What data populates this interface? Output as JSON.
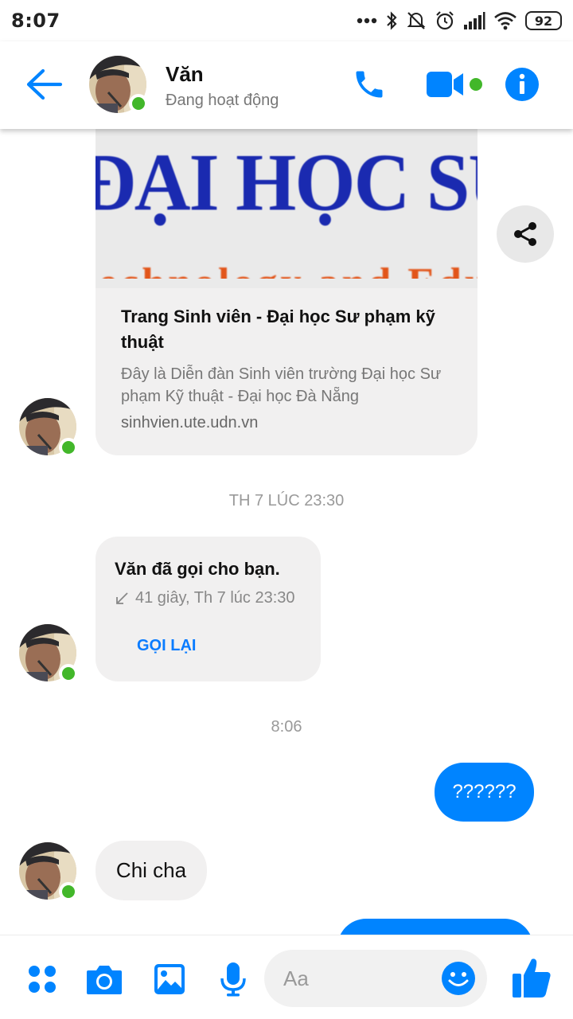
{
  "status_bar": {
    "time": "8:07",
    "battery": "92"
  },
  "header": {
    "contact_name": "Văn",
    "contact_status": "Đang hoạt động"
  },
  "link_preview": {
    "thumb_text": "ĐẠI HỌC SƯ",
    "thumb_subtext": "echnology and Educ",
    "title": "Trang Sinh viên - Đại học Sư phạm kỹ thuật",
    "description": "Đây là Diễn đàn Sinh viên trường Đại học Sư phạm Kỹ thuật - Đại học Đà Nẵng",
    "domain": "sinhvien.ute.udn.vn"
  },
  "timestamps": {
    "first": "TH 7 LÚC 23:30",
    "second": "8:06"
  },
  "call_card": {
    "title": "Văn đã gọi cho bạn.",
    "meta": "41 giây, Th 7 lúc 23:30",
    "action": "GỌI LẠI"
  },
  "messages": {
    "outgoing_1": "??????",
    "incoming_1": "Chi cha"
  },
  "composer": {
    "placeholder": "Aa"
  },
  "colors": {
    "accent": "#0084ff",
    "online": "#42b72a",
    "bubble_in": "#f1f0f0"
  },
  "icons": [
    "back-arrow-icon",
    "phone-icon",
    "video-camera-icon",
    "info-icon",
    "share-icon",
    "missed-call-arrow-icon",
    "apps-icon",
    "camera-icon",
    "gallery-icon",
    "microphone-icon",
    "emoji-icon",
    "thumbs-up-icon"
  ]
}
